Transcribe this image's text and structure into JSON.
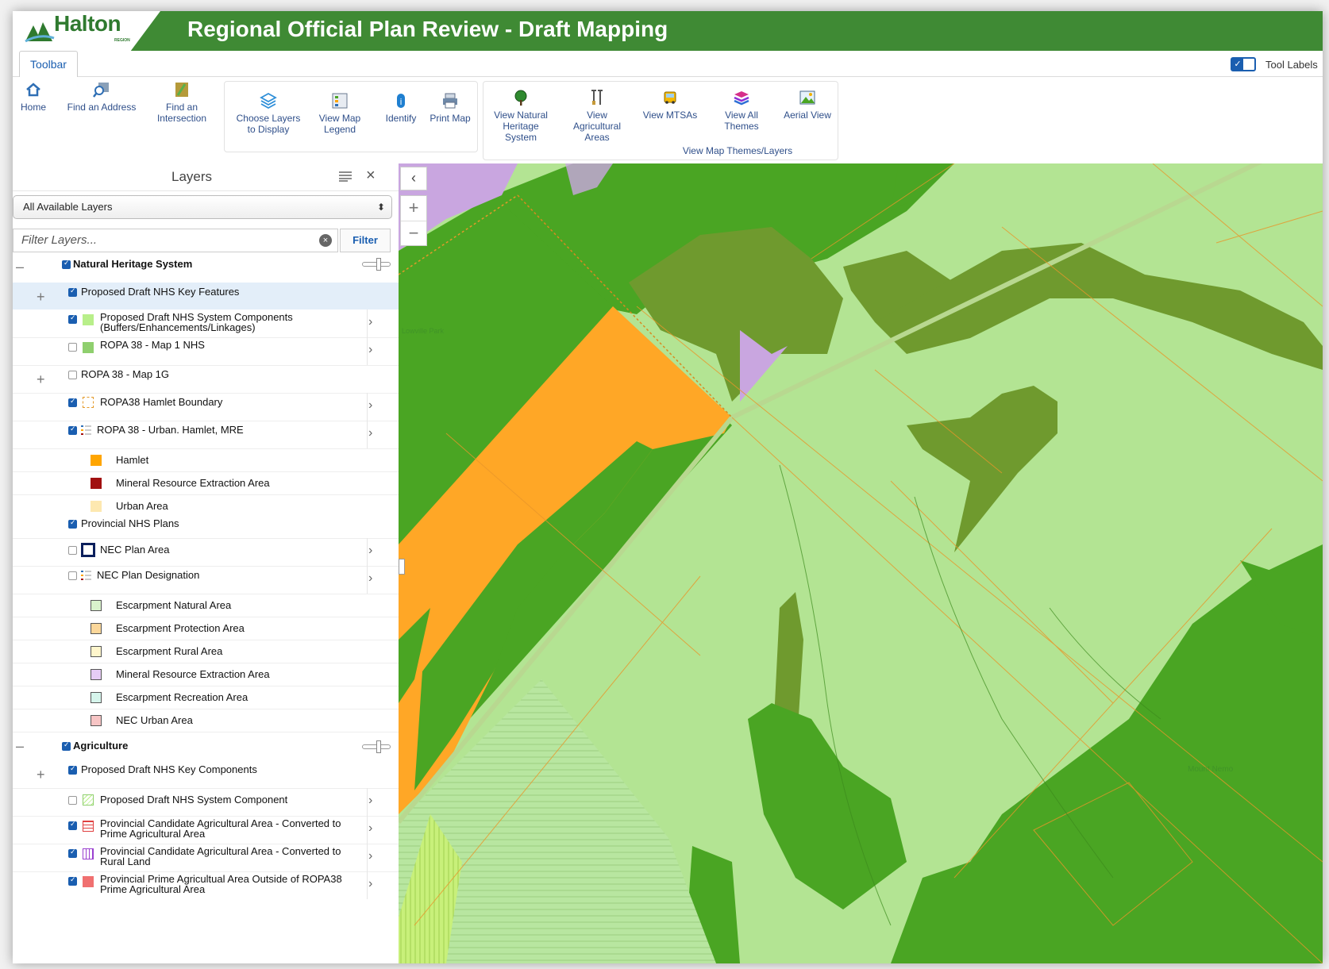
{
  "header": {
    "logo_text": "Halton",
    "logo_sub": "REGION",
    "title": "Regional Official Plan Review - Draft Mapping",
    "color": "#3f8a34"
  },
  "tabs": {
    "toolbar": "Toolbar",
    "tool_labels": "Tool Labels",
    "tool_labels_checked": true
  },
  "toolbar": {
    "home": "Home",
    "find_address": "Find an Address",
    "find_intersection_1": "Find an",
    "find_intersection_2": "Intersection",
    "choose_layers_1": "Choose Layers",
    "choose_layers_2": "to Display",
    "view_legend_1": "View Map",
    "view_legend_2": "Legend",
    "identify": "Identify",
    "print_map": "Print Map",
    "nhs_1": "View Natural",
    "nhs_2": "Heritage",
    "nhs_3": "System",
    "agri_1": "View",
    "agri_2": "Agricultural",
    "agri_3": "Areas",
    "mtsas": "View MTSAs",
    "all_themes": "View All Themes",
    "aerial": "Aerial View",
    "group_label": "View Map Themes/Layers"
  },
  "panel": {
    "title": "Layers",
    "select_value": "All Available Layers",
    "filter_placeholder": "Filter Layers...",
    "filter_button": "Filter",
    "layers": [
      {
        "label": "Natural Heritage System",
        "checked": true,
        "bold": true
      },
      {
        "label": "Proposed Draft NHS Key Features",
        "checked": true
      },
      {
        "label": "Proposed Draft NHS System Components",
        "label2": "(Buffers/Enhancements/Linkages)",
        "checked": true
      },
      {
        "label": "ROPA 38 - Map 1 NHS",
        "checked": false
      },
      {
        "label": "ROPA 38 - Map 1G",
        "checked": false
      },
      {
        "label": "ROPA38 Hamlet Boundary",
        "checked": true
      },
      {
        "label": "ROPA 38 - Urban. Hamlet, MRE",
        "checked": true
      },
      {
        "label": "Hamlet"
      },
      {
        "label": "Mineral Resource Extraction Area"
      },
      {
        "label": "Urban Area"
      },
      {
        "label": "Provincial NHS Plans",
        "checked": true
      },
      {
        "label": "NEC Plan Area",
        "checked": false
      },
      {
        "label": "NEC Plan Designation",
        "checked": false
      },
      {
        "label": "Escarpment Natural Area"
      },
      {
        "label": "Escarpment Protection Area"
      },
      {
        "label": "Escarpment Rural Area"
      },
      {
        "label": "Mineral Resource Extraction Area"
      },
      {
        "label": "Escarpment Recreation Area"
      },
      {
        "label": "NEC Urban Area"
      },
      {
        "label": "Agriculture",
        "checked": true,
        "bold": true
      },
      {
        "label": "Proposed Draft NHS Key Components",
        "checked": true
      },
      {
        "label": "Proposed Draft NHS System Component",
        "checked": false
      },
      {
        "label": "Provincial Candidate Agricultural Area - Converted to",
        "label2": "Prime Agricultural Area",
        "checked": true
      },
      {
        "label": "Provincial Candidate Agricultural Area - Converted to",
        "label2": "Rural Land",
        "checked": true
      },
      {
        "label": "Provincial Prime Agricultual Area Outside of ROPA38",
        "label2": "Prime Agricultural Area",
        "checked": true
      }
    ]
  },
  "colors": {
    "nhs_components": "#b8ef8a",
    "map1_nhs": "#8fcf6e",
    "hamlet": "#ffa500",
    "mre": "#a11010",
    "urban": "#fde8b0",
    "esc_natural": "#d9f2cc",
    "esc_protection": "#fbd79a",
    "esc_rural": "#fff6cc",
    "esc_mre": "#e6ccf5",
    "esc_recreation": "#d6f5ec",
    "nec_urban": "#f7c5c5",
    "prime_agri": "#f07070",
    "map_dark_green": "#4aa523",
    "map_light_green": "#b3e493",
    "map_olive": "#6f9a2e"
  },
  "map": {
    "label_1": "Mount Nemo",
    "label_2": "Lowville Park"
  }
}
